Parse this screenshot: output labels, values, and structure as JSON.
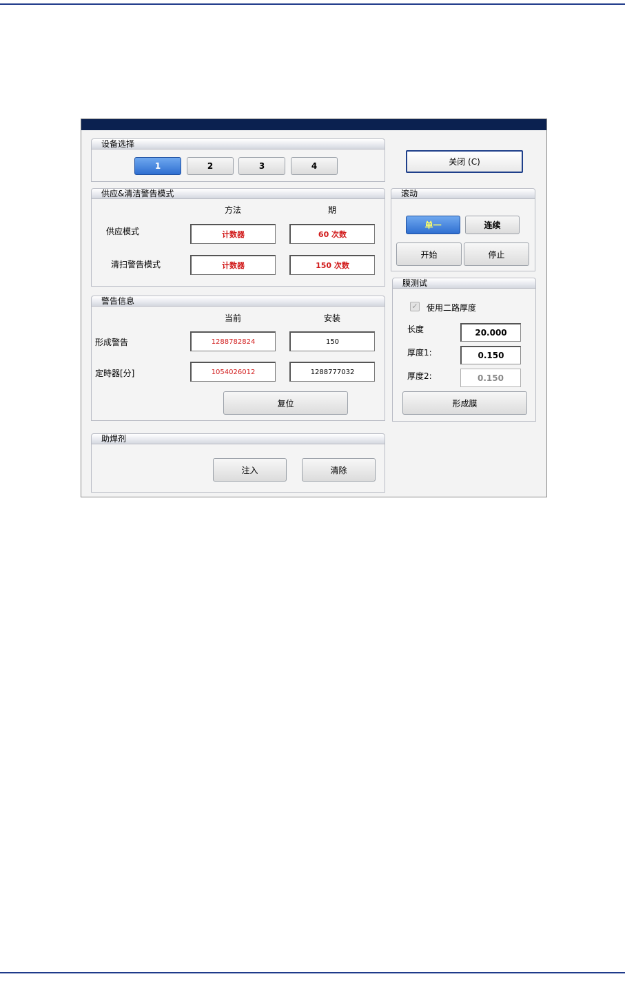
{
  "device_select": {
    "title": "设备选择",
    "buttons": [
      "1",
      "2",
      "3",
      "4"
    ],
    "selected": "1"
  },
  "close_button": "关闭 (C)",
  "supply_clean": {
    "title": "供应&清洁警告模式",
    "col_method": "方法",
    "col_period": "期",
    "rows": [
      {
        "label": "供应模式",
        "method": "计数器",
        "period": "60  次数"
      },
      {
        "label": "清扫警告模式",
        "method": "计数器",
        "period": "150  次数"
      }
    ]
  },
  "scroll": {
    "title": "滚动",
    "single": "单一",
    "continuous": "连续",
    "start": "开始",
    "stop": "停止"
  },
  "warning_info": {
    "title": "警告信息",
    "col_current": "当前",
    "col_installed": "安装",
    "rows": [
      {
        "label": "形成警告",
        "current": "1288782824",
        "installed": "150"
      },
      {
        "label": "定時器[分]",
        "current": "1054026012",
        "installed": "1288777032"
      }
    ],
    "reset": "复位"
  },
  "film_test": {
    "title": "膜测试",
    "checkbox_label": "使用二路厚度",
    "length_label": "长度",
    "length_value": "20.000",
    "thickness1_label": "厚度1:",
    "thickness1_value": "0.150",
    "thickness2_label": "厚度2:",
    "thickness2_value": "0.150",
    "form_button": "形成膜"
  },
  "flux": {
    "title": "助焊剂",
    "inject": "注入",
    "clear": "清除"
  },
  "colors": {
    "titlebar": "#0b2150",
    "selected_button": "#2f6fd1",
    "value_red": "#d11a1a",
    "page_line": "#1f3a8a"
  }
}
